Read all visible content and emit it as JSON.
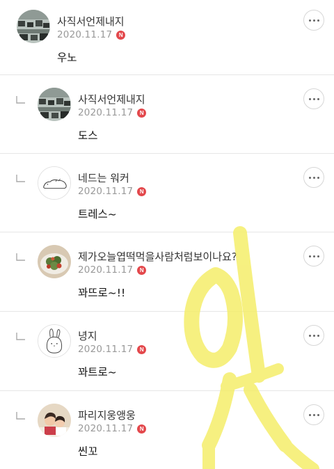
{
  "colors": {
    "badge": "#e3484c",
    "highlighter": "#f5ee6a"
  },
  "comments": [
    {
      "name": "사직서언제내지",
      "date": "2020.11.17",
      "badge": "N",
      "text": "우노",
      "reply": false,
      "avatar_icon": "office-photo-icon"
    },
    {
      "name": "사직서언제내지",
      "date": "2020.11.17",
      "badge": "N",
      "text": "도스",
      "reply": true,
      "avatar_icon": "office-photo-icon"
    },
    {
      "name": "네드는 워커",
      "date": "2020.11.17",
      "badge": "N",
      "text": "트레스~",
      "reply": true,
      "avatar_icon": "lying-figure-icon"
    },
    {
      "name": "제가오늘엽떡먹을사람처럼보이나요?",
      "date": "2020.11.17",
      "badge": "N",
      "text": "꽈뜨로~!!",
      "reply": true,
      "avatar_icon": "salad-photo-icon"
    },
    {
      "name": "녕지",
      "date": "2020.11.17",
      "badge": "N",
      "text": "꽈트로~",
      "reply": true,
      "avatar_icon": "bunny-drawing-icon"
    },
    {
      "name": "파리지웅앵웅",
      "date": "2020.11.17",
      "badge": "N",
      "text": "씬꼬",
      "reply": true,
      "avatar_icon": "people-photo-icon"
    }
  ],
  "highlighter_text": "아싱"
}
